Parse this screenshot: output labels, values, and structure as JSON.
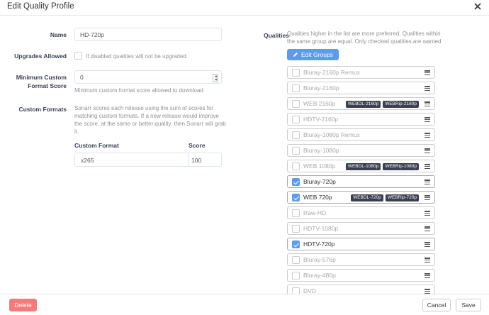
{
  "modal": {
    "title": "Edit Quality Profile"
  },
  "name": {
    "label": "Name",
    "value": "HD-720p"
  },
  "upgrades": {
    "label": "Upgrades Allowed",
    "help": "If disabled qualities will not be upgraded"
  },
  "min_score": {
    "label_line1": "Minimum Custom",
    "label_line2": "Format Score",
    "value": "0",
    "help": "Minimum custom format score allowed to download"
  },
  "custom_formats": {
    "label": "Custom Formats",
    "help_lines": [
      "Sonarr scores each release using the sum of scores for",
      "matching custom formats. If a new release would improve",
      "the score, at the same or better quality, then Sonarr will grab",
      "it."
    ],
    "col_format": "Custom Format",
    "col_score": "Score",
    "rows": [
      {
        "name": "x265",
        "score": "100"
      }
    ]
  },
  "qualities": {
    "label": "Qualities",
    "help_line1": "Qualities higher in the list are more preferred. Qualities within",
    "help_line2": "the same group are equal. Only checked qualities are wanted",
    "edit_groups": "Edit Groups",
    "items": [
      {
        "name": "Bluray-2160p Remux",
        "checked": false,
        "tags": []
      },
      {
        "name": "Bluray-2160p",
        "checked": false,
        "tags": []
      },
      {
        "name": "WEB 2160p",
        "checked": false,
        "tags": [
          "WEBDL-2160p",
          "WEBRip-2160p"
        ]
      },
      {
        "name": "HDTV-2160p",
        "checked": false,
        "tags": []
      },
      {
        "name": "Bluray-1080p Remux",
        "checked": false,
        "tags": []
      },
      {
        "name": "Bluray-1080p",
        "checked": false,
        "tags": []
      },
      {
        "name": "WEB 1080p",
        "checked": false,
        "tags": [
          "WEBDL-1080p",
          "WEBRip-1080p"
        ]
      },
      {
        "name": "Bluray-720p",
        "checked": true,
        "tags": []
      },
      {
        "name": "WEB 720p",
        "checked": true,
        "tags": [
          "WEBDL-720p",
          "WEBRip-720p"
        ]
      },
      {
        "name": "Raw-HD",
        "checked": false,
        "tags": []
      },
      {
        "name": "HDTV-1080p",
        "checked": false,
        "tags": []
      },
      {
        "name": "HDTV-720p",
        "checked": true,
        "tags": []
      },
      {
        "name": "Bluray-576p",
        "checked": false,
        "tags": []
      },
      {
        "name": "Bluray-480p",
        "checked": false,
        "tags": []
      },
      {
        "name": "DVD",
        "checked": false,
        "tags": []
      }
    ]
  },
  "footer": {
    "delete": "Delete",
    "cancel": "Cancel",
    "save": "Save"
  },
  "colors": {
    "primary": "#5d9cec",
    "danger": "#f05050",
    "tag": "#3a3f51"
  },
  "icons": {
    "close": "close-icon",
    "edit": "pencil-icon",
    "drag": "drag-handle-icon"
  }
}
